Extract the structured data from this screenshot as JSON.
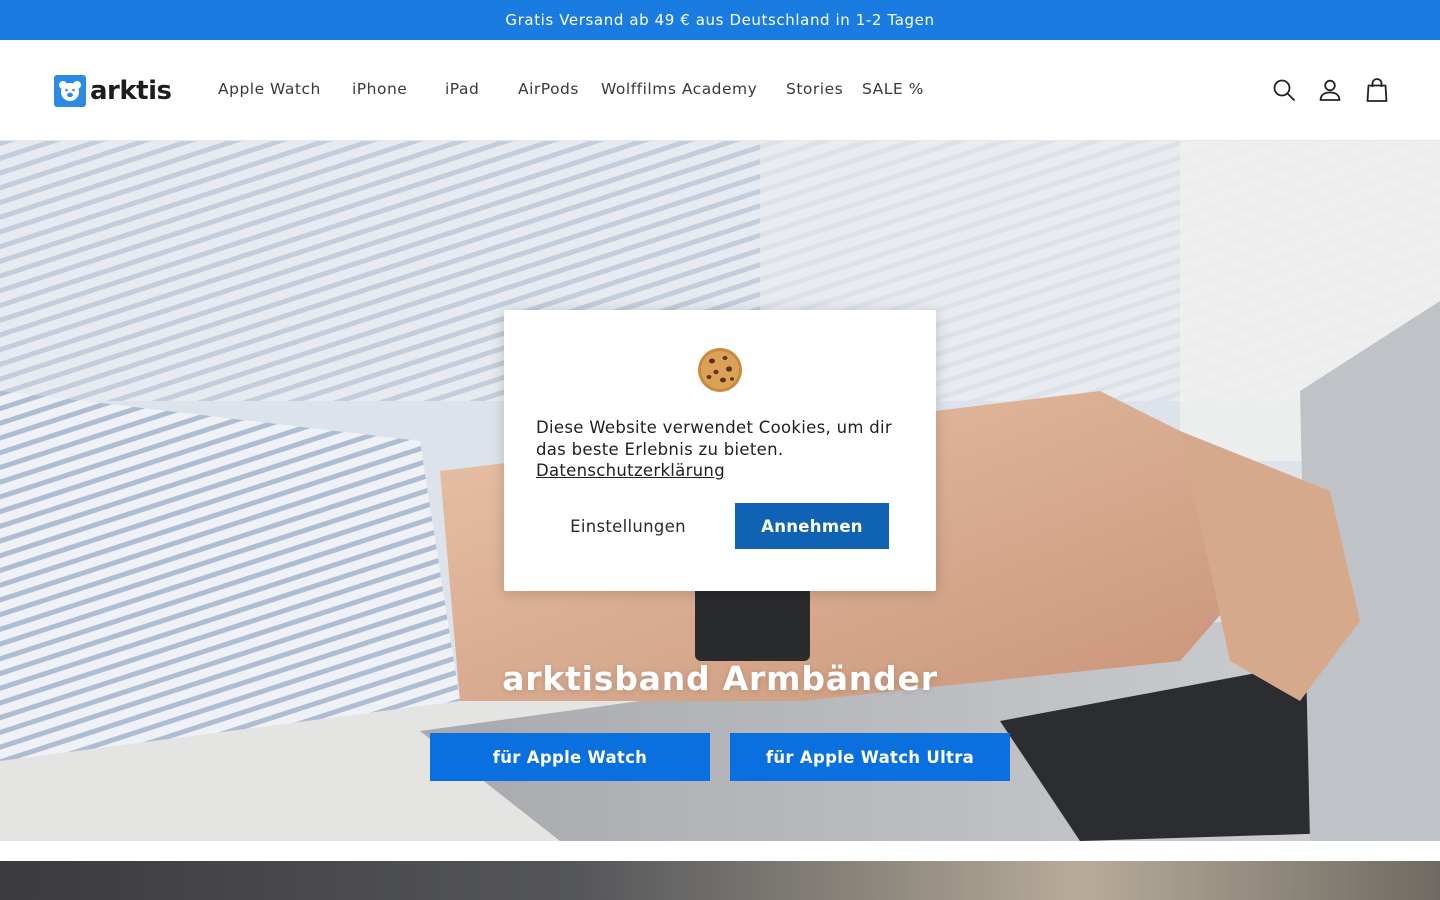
{
  "announcement": {
    "text": "Gratis Versand ab 49 € aus Deutschland in 1-2 Tagen"
  },
  "header": {
    "logo_text": "arktis",
    "nav": [
      {
        "label": "Apple Watch"
      },
      {
        "label": "iPhone"
      },
      {
        "label": "iPad"
      },
      {
        "label": "AirPods"
      },
      {
        "label": "Wolffilms Academy"
      },
      {
        "label": "Stories"
      },
      {
        "label": "SALE %"
      }
    ],
    "icons": [
      "search-icon",
      "account-icon",
      "cart-icon"
    ]
  },
  "hero": {
    "title": "arktisband Armbänder",
    "buttons": [
      {
        "label": "für Apple Watch"
      },
      {
        "label": "für Apple Watch Ultra"
      }
    ]
  },
  "cookie_banner": {
    "icon": "cookie-icon",
    "message": "Diese Website verwendet Cookies, um dir das beste Erlebnis zu bieten.",
    "privacy_link": "Datenschutzerklärung",
    "settings_label": "Einstellungen",
    "accept_label": "Annehmen"
  },
  "colors": {
    "announcement_bg": "#1a7be0",
    "hero_button_bg": "#0a6fdf",
    "accept_button_bg": "#1063b4",
    "logo_mark": "#2b8ae6"
  }
}
